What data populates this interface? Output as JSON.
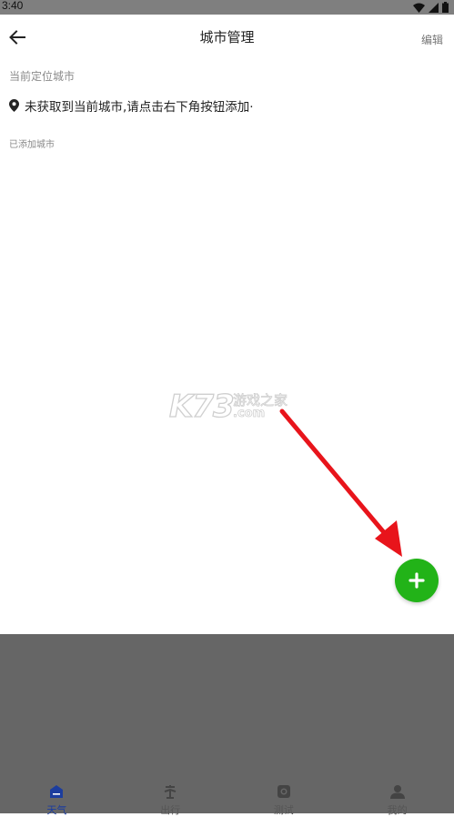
{
  "status_bar": {
    "time": "3:40"
  },
  "header": {
    "title": "城市管理",
    "edit_label": "编辑"
  },
  "current_location": {
    "section_label": "当前定位城市",
    "message": "未获取到当前城市,请点击右下角按钮添加·"
  },
  "added_cities": {
    "section_label": "已添加城市",
    "items": []
  },
  "watermark": {
    "logo_text": "K73",
    "cn_text": "游戏之家",
    "domain_text": ".com"
  },
  "fab": {
    "icon": "plus-icon",
    "color": "#22b318"
  },
  "bottom_nav": {
    "items": [
      {
        "label": "天气",
        "icon": "home-icon",
        "active": true
      },
      {
        "label": "出行",
        "icon": "travel-icon",
        "active": false
      },
      {
        "label": "测试",
        "icon": "camera-icon",
        "active": false
      },
      {
        "label": "我的",
        "icon": "person-icon",
        "active": false
      }
    ]
  },
  "colors": {
    "accent": "#1c3d9e",
    "fab": "#22b318",
    "arrow": "#e8141b",
    "scrim": "#666666"
  }
}
